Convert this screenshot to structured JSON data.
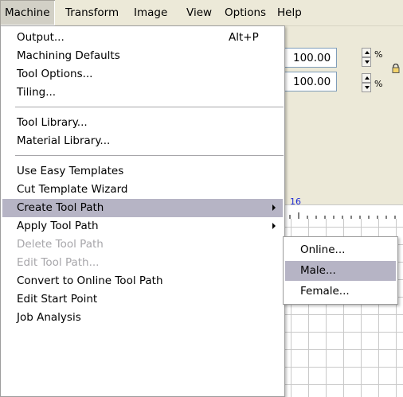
{
  "menubar": {
    "items": [
      {
        "label": "Machine",
        "active": true
      },
      {
        "label": "Transform"
      },
      {
        "label": "Image"
      },
      {
        "label": "View"
      },
      {
        "label": "Options"
      },
      {
        "label": "Help"
      }
    ]
  },
  "background": {
    "field1_value": "100.00",
    "field2_value": "100.00",
    "percent_sign": "%",
    "ruler_label": "16"
  },
  "machine_menu": {
    "items": [
      {
        "label": "Output...",
        "shortcut": "Alt+P"
      },
      {
        "label": "Machining Defaults"
      },
      {
        "label": "Tool Options..."
      },
      {
        "label": "Tiling..."
      },
      {
        "label": "Tool Library..."
      },
      {
        "label": "Material Library..."
      },
      {
        "label": "Use Easy Templates"
      },
      {
        "label": "Cut Template Wizard"
      },
      {
        "label": "Create Tool Path",
        "submenu": true,
        "highlighted": true
      },
      {
        "label": "Apply Tool Path",
        "submenu": true
      },
      {
        "label": "Delete Tool Path",
        "disabled": true
      },
      {
        "label": "Edit Tool Path...",
        "disabled": true
      },
      {
        "label": "Convert to Online Tool Path"
      },
      {
        "label": "Edit Start Point"
      },
      {
        "label": "Job Analysis"
      }
    ]
  },
  "create_tool_path_submenu": {
    "items": [
      {
        "label": "Online..."
      },
      {
        "label": "Male...",
        "highlighted": true
      },
      {
        "label": "Female..."
      }
    ]
  },
  "colors": {
    "highlight": "#b6b4c5",
    "disabled_text": "#a7a6aa",
    "menubar_bg": "#ece9d8",
    "ruler_text": "#1f2bd6"
  }
}
